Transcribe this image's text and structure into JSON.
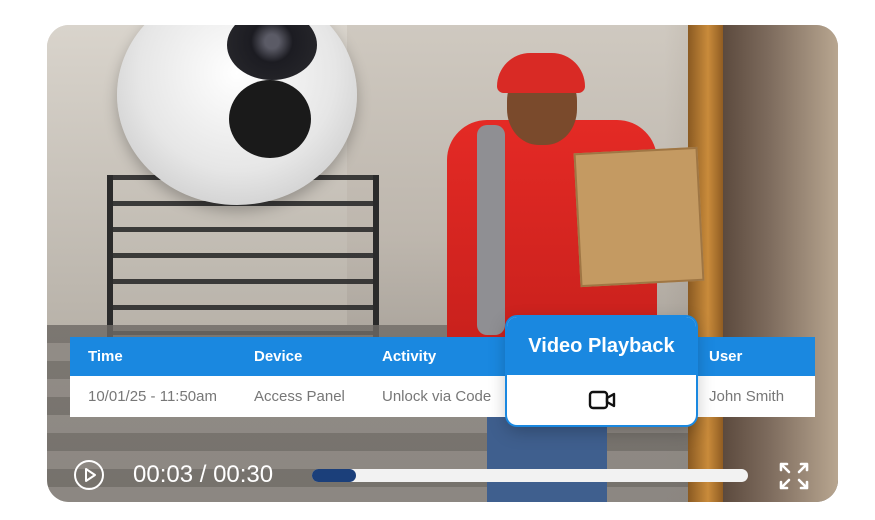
{
  "table": {
    "headers": [
      "Time",
      "Device",
      "Activity",
      "User"
    ],
    "row": {
      "time": "10/01/25 - 11:50am",
      "device": "Access Panel",
      "activity": "Unlock via Code",
      "user": "John Smith"
    },
    "highlight_title": "Video Playback",
    "highlight_icon": "video-camera-icon"
  },
  "player": {
    "time_display": "00:03 / 00:30",
    "progress": 0.1,
    "play_icon": "play-icon",
    "fullscreen_icon": "fullscreen-icon"
  },
  "colors": {
    "accent": "#1a88e0",
    "progress_fill": "#1b3f7a",
    "track": "#f2f2f2"
  }
}
